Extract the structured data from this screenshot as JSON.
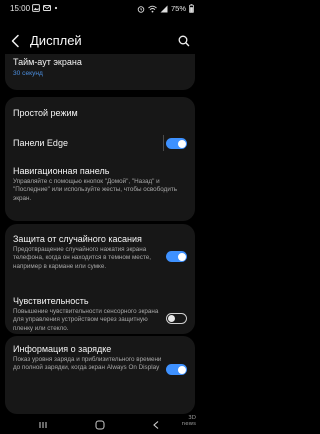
{
  "status": {
    "time": "15:00",
    "battery": "75%"
  },
  "header": {
    "title": "Дисплей"
  },
  "settings": {
    "screen_timeout": {
      "title": "Тайм-аут экрана",
      "value": "30 секунд"
    },
    "easy_mode": {
      "title": "Простой режим"
    },
    "edge_panels": {
      "title": "Панели Edge",
      "enabled": true
    },
    "navigation_bar": {
      "title": "Навигационная панель",
      "desc": "Управляйте с помощью кнопок \"Домой\", \"Назад\" и \"Последние\" или используйте жесты, чтобы освободить экран."
    },
    "accidental_touch": {
      "title": "Защита от случайного касания",
      "desc": "Предотвращение случайного нажатия экрана телефона, когда он находится в темном месте, например в кармане или сумке.",
      "enabled": true
    },
    "touch_sensitivity": {
      "title": "Чувствительность",
      "desc": "Повышение чувствительности сенсорного экрана для управления устройством через защитную пленку или стекло.",
      "enabled": false
    },
    "charging_info": {
      "title": "Информация о зарядке",
      "desc": "Показ уровня заряда и приблизительного времени до полной зарядки, когда экран Always On Display",
      "enabled": true
    }
  },
  "watermark": {
    "line1": "3D",
    "line2": "news"
  },
  "colors": {
    "accent": "#3e91ff",
    "card": "#171717",
    "background": "#000000"
  }
}
